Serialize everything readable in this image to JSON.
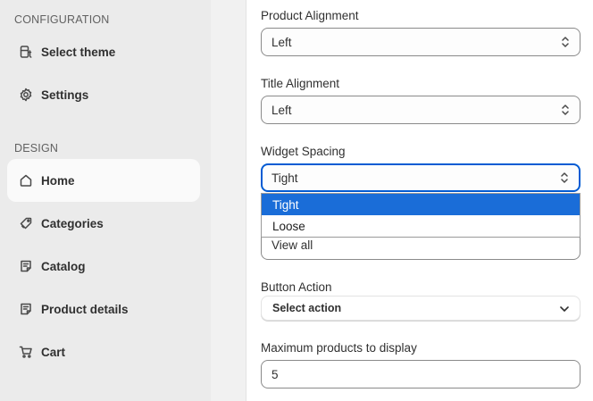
{
  "sidebar": {
    "configuration_label": "CONFIGURATION",
    "configuration_items": [
      {
        "label": "Select theme",
        "icon": "theme-icon"
      },
      {
        "label": "Settings",
        "icon": "gear-icon"
      }
    ],
    "design_label": "DESIGN",
    "design_items": [
      {
        "label": "Home",
        "icon": "home-icon",
        "active": true
      },
      {
        "label": "Categories",
        "icon": "tag-icon"
      },
      {
        "label": "Catalog",
        "icon": "catalog-icon"
      },
      {
        "label": "Product details",
        "icon": "product-details-icon"
      },
      {
        "label": "Cart",
        "icon": "cart-icon"
      }
    ]
  },
  "form": {
    "product_alignment": {
      "label": "Product Alignment",
      "value": "Left"
    },
    "title_alignment": {
      "label": "Title Alignment",
      "value": "Left"
    },
    "widget_spacing": {
      "label": "Widget Spacing",
      "value": "Tight",
      "options": [
        "Tight",
        "Loose"
      ],
      "highlighted": "Tight"
    },
    "view_all": {
      "value": "View all"
    },
    "button_action": {
      "label": "Button Action",
      "value": "Select action"
    },
    "max_products": {
      "label": "Maximum products to display",
      "value": "5"
    }
  },
  "colors": {
    "accent": "#005bd3",
    "highlight": "#1a6dd8",
    "sidebar_bg": "#ebebeb"
  }
}
